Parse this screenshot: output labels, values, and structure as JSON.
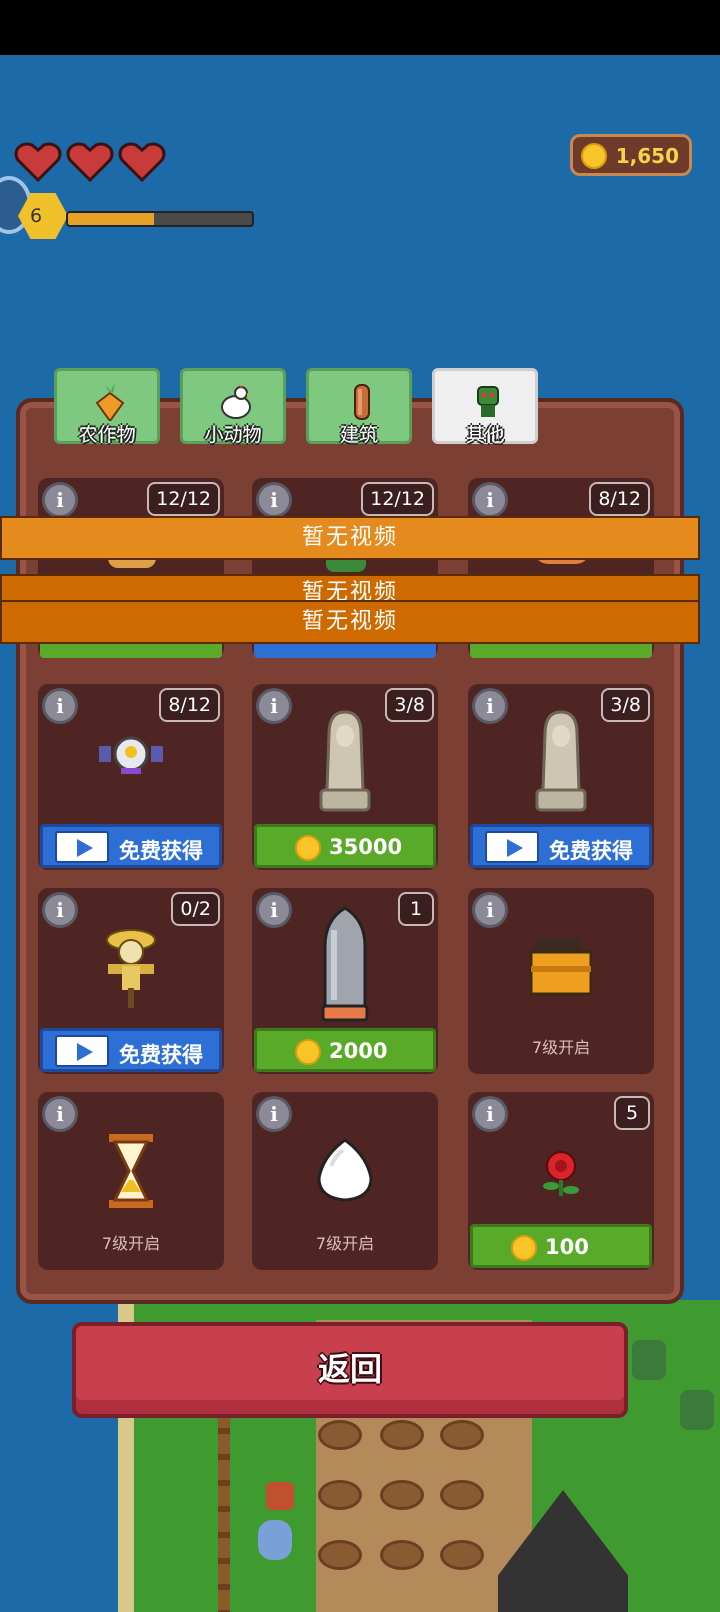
{
  "hud": {
    "hearts": 3,
    "level": "6",
    "xp_progress": 0.47,
    "coins": "1,650"
  },
  "tabs": [
    {
      "label": "农作物",
      "icon": "carrot-icon",
      "active": false
    },
    {
      "label": "小动物",
      "icon": "chicken-icon",
      "active": false
    },
    {
      "label": "建筑",
      "icon": "fence-post-icon",
      "active": false
    },
    {
      "label": "其他",
      "icon": "goblin-icon",
      "active": true
    }
  ],
  "banners": [
    {
      "text": "暂无视频"
    },
    {
      "text": "暂无视频"
    },
    {
      "text": "暂无视频"
    }
  ],
  "row1": [
    {
      "count": "12/12",
      "icon": "straw-hat-pet-icon",
      "button": "coin"
    },
    {
      "count": "12/12",
      "icon": "goblin-pet-icon",
      "button": "video"
    },
    {
      "count": "8/12",
      "icon": "crab-pet-icon",
      "button": "coin"
    }
  ],
  "cards": [
    {
      "count": "8/12",
      "icon": "robot-drone-icon",
      "button_type": "video",
      "button_text": "免费获得"
    },
    {
      "count": "3/8",
      "icon": "praying-statue-icon",
      "button_type": "coin",
      "button_text": "35000"
    },
    {
      "count": "3/8",
      "icon": "praying-statue-icon",
      "button_type": "video",
      "button_text": "免费获得"
    },
    {
      "count": "0/2",
      "icon": "scarecrow-icon",
      "button_type": "video",
      "button_text": "免费获得"
    },
    {
      "count": "1",
      "icon": "bullet-statue-icon",
      "button_type": "coin",
      "button_text": "2000"
    },
    {
      "count": "",
      "icon": "treasure-box-icon",
      "button_type": "locked",
      "button_text": "7级开启"
    },
    {
      "count": "",
      "icon": "hourglass-icon",
      "button_type": "locked",
      "button_text": "7级开启"
    },
    {
      "count": "",
      "icon": "egg-icon",
      "button_type": "locked",
      "button_text": "7级开启"
    },
    {
      "count": "5",
      "icon": "rose-icon",
      "button_type": "coin",
      "button_text": "100"
    }
  ],
  "back_button": "返回",
  "info_symbol": "i"
}
